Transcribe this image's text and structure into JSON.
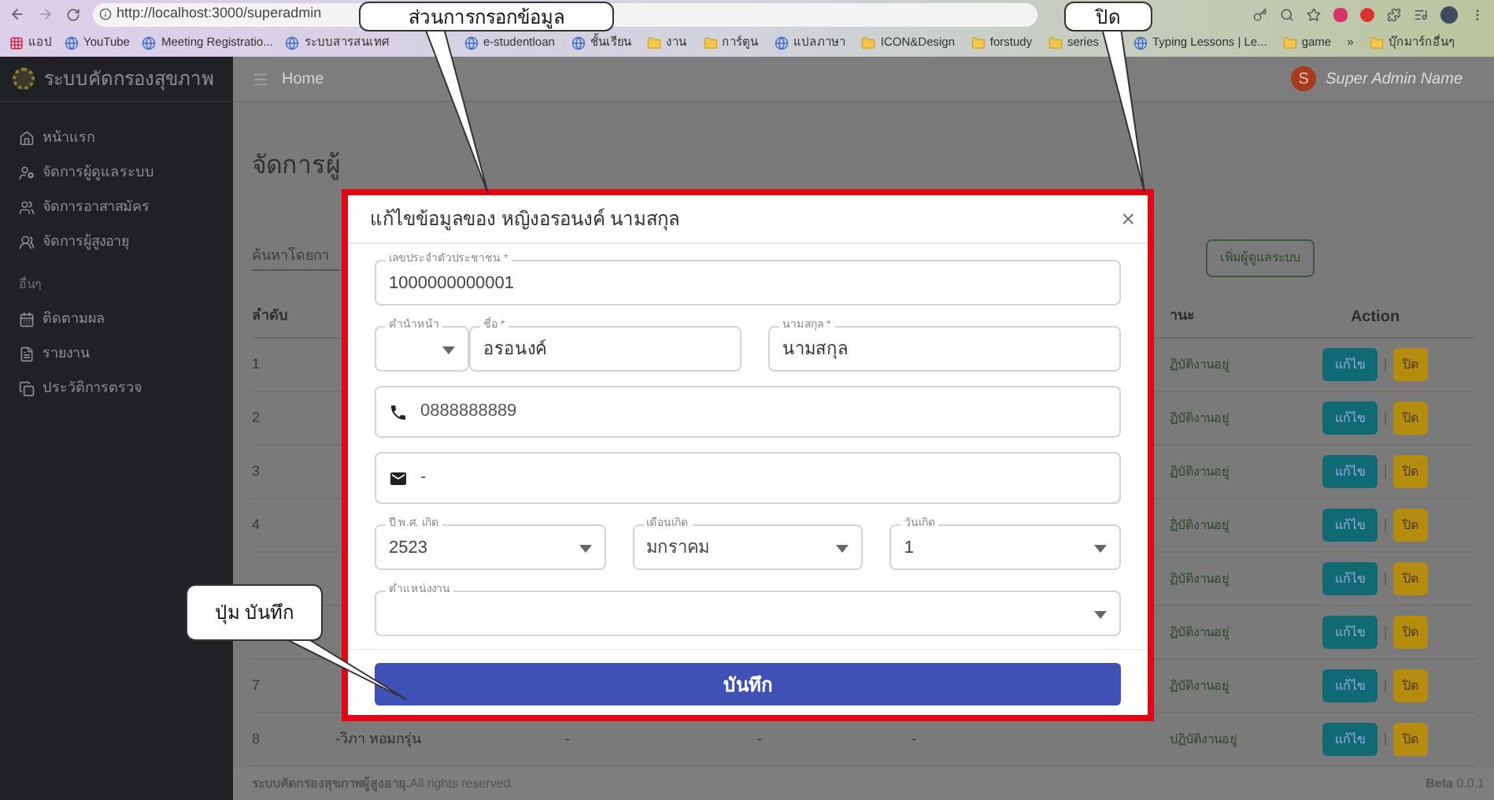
{
  "browser": {
    "url": "http://localhost:3000/superadmin",
    "bookmarks": [
      {
        "kind": "apps",
        "label": "แอป"
      },
      {
        "kind": "site",
        "label": "YouTube"
      },
      {
        "kind": "site",
        "label": "Meeting Registratio..."
      },
      {
        "kind": "site",
        "label": "ระบบสารสนเทศ"
      },
      {
        "kind": "site",
        "label": "e-studentloan"
      },
      {
        "kind": "site",
        "label": "ชั้นเรียน"
      },
      {
        "kind": "folder",
        "label": "งาน"
      },
      {
        "kind": "folder",
        "label": "การ์ตูน"
      },
      {
        "kind": "site",
        "label": "แปลภาษา"
      },
      {
        "kind": "folder",
        "label": "ICON&Design"
      },
      {
        "kind": "folder",
        "label": "forstudy"
      },
      {
        "kind": "folder",
        "label": "series"
      },
      {
        "kind": "site",
        "label": "Typing Lessons | Le..."
      },
      {
        "kind": "folder",
        "label": "game"
      },
      {
        "kind": "more",
        "label": "»"
      },
      {
        "kind": "folder",
        "label": "บุ๊กมาร์กอื่นๆ"
      }
    ]
  },
  "sidebar": {
    "brand": "ระบบคัดกรองสุขภาพ",
    "items": [
      {
        "kind": "link",
        "label": "หน้าแรก"
      },
      {
        "kind": "link",
        "label": "จัดการผู้ดูแลระบบ"
      },
      {
        "kind": "link",
        "label": "จัดการอาสาสมัคร"
      },
      {
        "kind": "link",
        "label": "จัดการผู้สูงอายุ"
      },
      {
        "kind": "heading",
        "label": "อื่นๆ"
      },
      {
        "kind": "link",
        "label": "ติดตามผล"
      },
      {
        "kind": "link",
        "label": "รายงาน"
      },
      {
        "kind": "link",
        "label": "ประวัติการตรวจ"
      }
    ]
  },
  "header": {
    "breadcrumb": "Home",
    "avatar_letter": "S",
    "user_name": "Super Admin Name"
  },
  "page": {
    "title": "จัดการผู้",
    "search": {
      "placeholder": "ค้นหาโดยกา"
    },
    "add_button": "เพิ่มผู้ดูแลระบบ"
  },
  "table": {
    "columns": {
      "number": "ลำดับ",
      "status": "านะ",
      "action": "Action"
    },
    "rows": [
      {
        "number": "1",
        "status": "ฏิบัติงานอยู่",
        "edit": "แก้ไข",
        "divider": "|",
        "close": "ปิด"
      },
      {
        "number": "2",
        "status": "ฏิบัติงานอยู่",
        "edit": "แก้ไข",
        "divider": "|",
        "close": "ปิด"
      },
      {
        "number": "3",
        "status": "ฏิบัติงานอยู่",
        "edit": "แก้ไข",
        "divider": "|",
        "close": "ปิด"
      },
      {
        "number": "4",
        "status": "ฏิบัติงานอยู่",
        "edit": "แก้ไข",
        "divider": "|",
        "close": "ปิด"
      },
      {
        "status": "ฏิบัติงานอยู่",
        "edit": "แก้ไข",
        "divider": "|",
        "close": "ปิด"
      },
      {
        "status": "ฏิบัติงานอยู่",
        "edit": "แก้ไข",
        "divider": "|",
        "close": "ปิด"
      },
      {
        "number": "7",
        "status": "ฏิบัติงานอยู่",
        "edit": "แก้ไข",
        "divider": "|",
        "close": "ปิด"
      },
      {
        "number": "8",
        "name": "-วิภา หอมกรุ่น",
        "column_3": "-",
        "column_4": "-",
        "column_5": "-",
        "status": "ปฏิบัติงานอยู่",
        "edit": "แก้ไข",
        "divider": "|",
        "close": "ปิด"
      }
    ]
  },
  "footer": {
    "text": "**ระบบคัดกรองสุขภาพผู้สูงอายุ.**All rights reserved.",
    "version": "**Beta** 0.0.1"
  },
  "modal": {
    "title": "แก้ไขข้อมูลของ หญิงอรอนงค์ นามสกุล",
    "close": "×",
    "id_field": {
      "label": "เลขประจำตัวประชาชน *",
      "value": "1000000000001"
    },
    "prefix_select": {
      "label": "คำนำหน้า"
    },
    "first_name": {
      "label": "ชื่อ *",
      "value": "อรอนงค์"
    },
    "last_name": {
      "label": "นามสกุล *",
      "value": "นามสกุล"
    },
    "phone": {
      "value": "0888888889"
    },
    "email": {
      "value": "-"
    },
    "birth_selects": [
      {
        "label": "ปี พ.ศ. เกิด",
        "value": "2523"
      },
      {
        "label": "เดือนเกิด",
        "value": "มกราคม"
      },
      {
        "label": "วันเกิด",
        "value": "1"
      }
    ],
    "position_select": {
      "label": "ตำแหน่งงาน"
    },
    "save_button": "บันทึก"
  },
  "callouts": [
    {
      "kind": "form",
      "text": "ส่วนการกรอกข้อมูล"
    },
    {
      "kind": "close",
      "text": "ปิด"
    },
    {
      "kind": "save",
      "text": "ปุ่ม บันทึก"
    }
  ]
}
